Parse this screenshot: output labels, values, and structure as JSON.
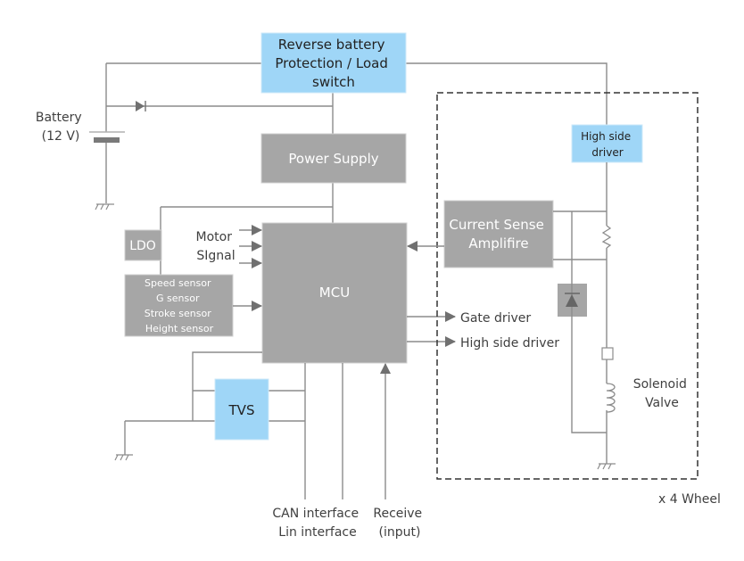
{
  "blocks": {
    "reverse_battery": [
      "Reverse battery",
      "Protection / Load",
      "switch"
    ],
    "power_supply": "Power Supply",
    "ldo": "LDO",
    "sensors": [
      "Speed sensor",
      "G sensor",
      "Stroke sensor",
      "Height sensor"
    ],
    "mcu": "MCU",
    "tvs": "TVS",
    "current_sense": [
      "Current Sense",
      "Amplifire"
    ],
    "high_side_driver_block": [
      "High side",
      "driver"
    ]
  },
  "labels": {
    "battery": [
      "Battery",
      "(12 V)"
    ],
    "motor_signal": [
      "Motor",
      "SIgnal"
    ],
    "gate_driver": "Gate driver",
    "high_side_driver": "High side driver",
    "solenoid": [
      "Solenoid",
      "Valve"
    ],
    "wheel_multiplier": "x 4 Wheel",
    "can_lin": [
      "CAN interface",
      "Lin interface"
    ],
    "receive": [
      "Receive",
      "(input)"
    ]
  },
  "colors": {
    "gray_block": "#a6a6a6",
    "blue_block": "#9fd6f7",
    "wire": "#8c8c8c"
  }
}
